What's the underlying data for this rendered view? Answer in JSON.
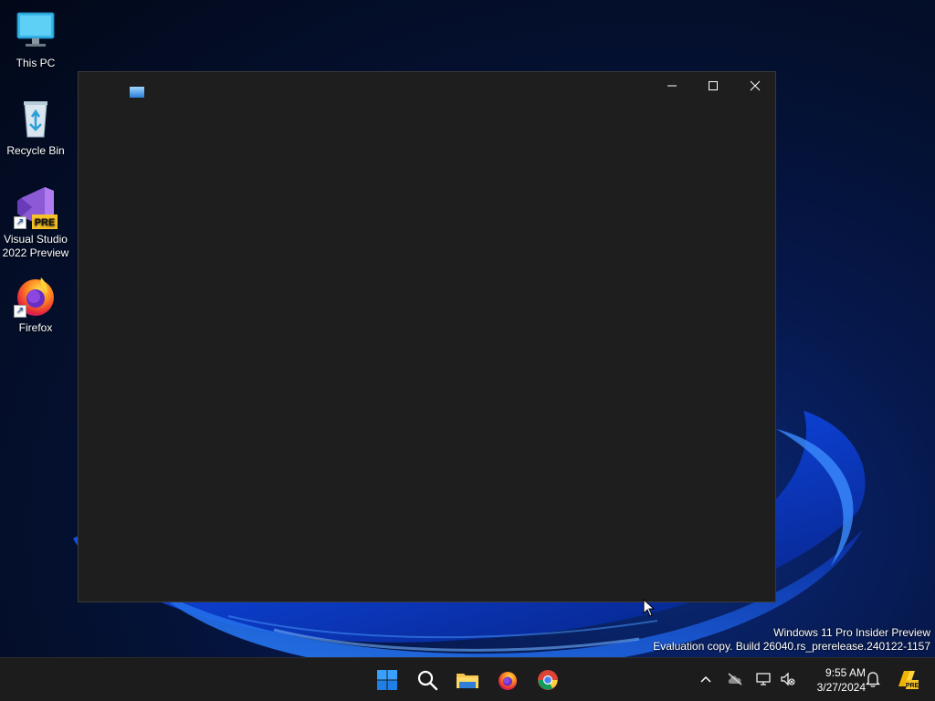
{
  "desktop": {
    "icons": [
      {
        "label": "This PC",
        "icon": "this-pc-icon"
      },
      {
        "label": "Recycle Bin",
        "icon": "recycle-bin-icon"
      },
      {
        "label": "Visual Studio 2022 Preview",
        "icon": "visual-studio-preview-icon",
        "badge": "PRE"
      },
      {
        "label": "Firefox",
        "icon": "firefox-icon"
      }
    ]
  },
  "window": {
    "title": "",
    "app_icon": "app-icon",
    "controls": {
      "minimize": "minimize-icon",
      "maximize": "maximize-icon",
      "close": "close-icon"
    },
    "background": "#1e1e1e"
  },
  "watermark": {
    "line1": "Windows 11 Pro Insider Preview",
    "line2": "Evaluation copy. Build 26040.rs_prerelease.240122-1157"
  },
  "taskbar": {
    "pinned": [
      {
        "name": "start",
        "icon": "windows-logo-icon"
      },
      {
        "name": "search",
        "icon": "search-icon"
      },
      {
        "name": "file-explorer",
        "icon": "folder-icon"
      },
      {
        "name": "firefox",
        "icon": "firefox-icon"
      },
      {
        "name": "chrome",
        "icon": "chrome-icon"
      }
    ],
    "tray": {
      "icons": [
        "chevron-up-icon",
        "onedrive-offline-icon",
        "network-icon",
        "volume-muted-icon",
        "notification-bell-icon",
        "copilot-pre-icon"
      ],
      "time": "9:55 AM",
      "date": "3/27/2024"
    },
    "accent": "#0078d4"
  }
}
